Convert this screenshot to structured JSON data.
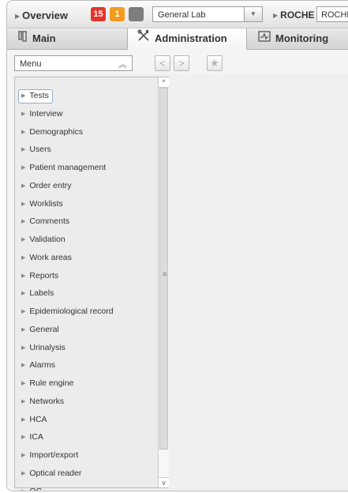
{
  "topbar": {
    "overview_label": "Overview",
    "badges": {
      "red": "15",
      "orange": "1",
      "gray": ""
    },
    "lab_select": "General Lab",
    "roche_label": "ROCHE",
    "roche_value": "ROCHE"
  },
  "tabs": [
    {
      "label": "Main",
      "icon": "flask-icon"
    },
    {
      "label": "Administration",
      "icon": "tools-icon"
    },
    {
      "label": "Monitoring",
      "icon": "monitor-icon"
    }
  ],
  "toolbar": {
    "menu_select": "Menu"
  },
  "menu_items": [
    "Tests",
    "Interview",
    "Demographics",
    "Users",
    "Patient management",
    "Order entry",
    "Worklists",
    "Comments",
    "Validation",
    "Work areas",
    "Reports",
    "Labels",
    "Epidemiological record",
    "General",
    "Urinalysis",
    "Alarms",
    "Rule engine",
    "Networks",
    "HCA",
    "ICA",
    "Import/export",
    "Optical reader",
    "QC"
  ],
  "colors": {
    "badge_red": "#e2352c",
    "badge_orange": "#f29b1d",
    "badge_gray": "#7d7d7d"
  }
}
